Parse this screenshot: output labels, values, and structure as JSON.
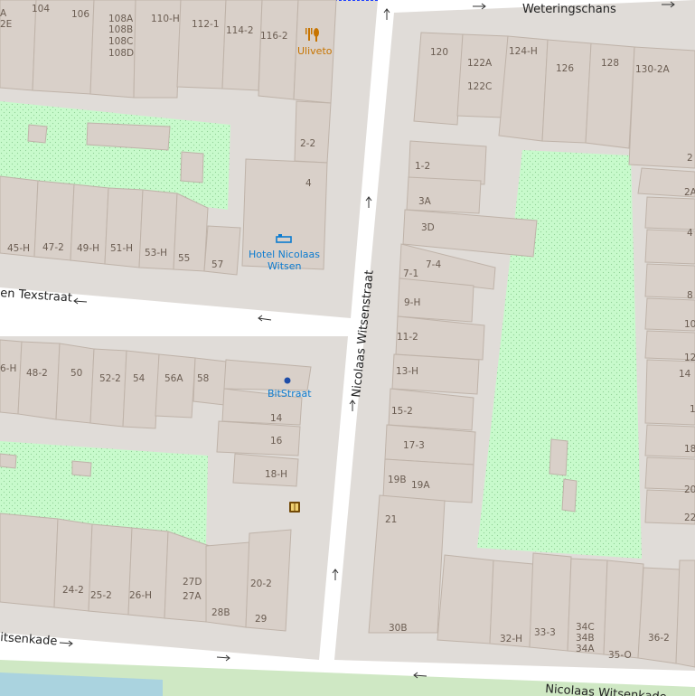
{
  "streets": {
    "top_right": "Weteringschans",
    "vertical": "Nicolaas Witsenstraat",
    "left_upper": "en Texstraat",
    "left_lower": "itsenkade",
    "bottom_right": "Nicolaas Witsenkade"
  },
  "pois": {
    "restaurant": {
      "name": "Uliveto",
      "icon": "restaurant-icon",
      "color": "#c77400"
    },
    "hotel": {
      "name_line1": "Hotel Nicolaas",
      "name_line2": "Witsen",
      "icon": "hotel-bed-icon",
      "color": "#0b7bd0"
    },
    "office": {
      "name": "BitStraat",
      "icon": "office-dot-icon",
      "color": "#0b7bd0"
    },
    "bookcase": {
      "icon": "public-bookcase-icon"
    }
  },
  "house_numbers": {
    "n_a": "A",
    "n_2e": "2E",
    "n_104": "104",
    "n_106": "106",
    "n_108a": "108A",
    "n_108b": "108B",
    "n_108c": "108C",
    "n_108d": "108D",
    "n_110h": "110-H",
    "n_112_1": "112-1",
    "n_114_2": "114-2",
    "n_116_2": "116-2",
    "n_2_2": "2-2",
    "n_4": "4",
    "n_45h": "45-H",
    "n_47_2": "47-2",
    "n_49h": "49-H",
    "n_51h": "51-H",
    "n_53h": "53-H",
    "n_55": "55",
    "n_57": "57",
    "n_6h": "6-H",
    "n_48_2": "48-2",
    "n_50": "50",
    "n_52_2": "52-2",
    "n_54": "54",
    "n_56a": "56A",
    "n_58": "58",
    "n_14": "14",
    "n_16": "16",
    "n_18h": "18-H",
    "n_24_2": "24-2",
    "n_25_2": "25-2",
    "n_26h": "26-H",
    "n_27d": "27D",
    "n_27a": "27A",
    "n_28b": "28B",
    "n_20_2": "20-2",
    "n_29": "29",
    "n_120": "120",
    "n_122a": "122A",
    "n_122c": "122C",
    "n_124h": "124-H",
    "n_126": "126",
    "n_128": "128",
    "n_130_2a": "130-2A",
    "n_1_2": "1-2",
    "n_3a": "3A",
    "n_3d": "3D",
    "n_7_4": "7-4",
    "n_7_1": "7-1",
    "n_9h": "9-H",
    "n_11_2": "11-2",
    "n_13h": "13-H",
    "n_15_2": "15-2",
    "n_17_3": "17-3",
    "n_19b": "19B",
    "n_19a": "19A",
    "n_21": "21",
    "n_30b": "30B",
    "n_32h": "32-H",
    "n_33_3": "33-3",
    "n_34c": "34C",
    "n_34b": "34B",
    "n_34a": "34A",
    "n_35o": "35-O",
    "n_36_2": "36-2",
    "e_2": "2",
    "e_2a": "2A",
    "e_4": "4",
    "e_8": "8",
    "e_10": "10",
    "e_12": "12",
    "e_14": "14",
    "e_1": "1",
    "e_18": "18",
    "e_20": "20",
    "e_22": "22"
  },
  "colors": {
    "background": "#f2efe9",
    "block": "#e0dcd8",
    "building": "#d9d0c9",
    "park": "#c8facc",
    "road": "#ffffff",
    "water": "#aad3df"
  }
}
